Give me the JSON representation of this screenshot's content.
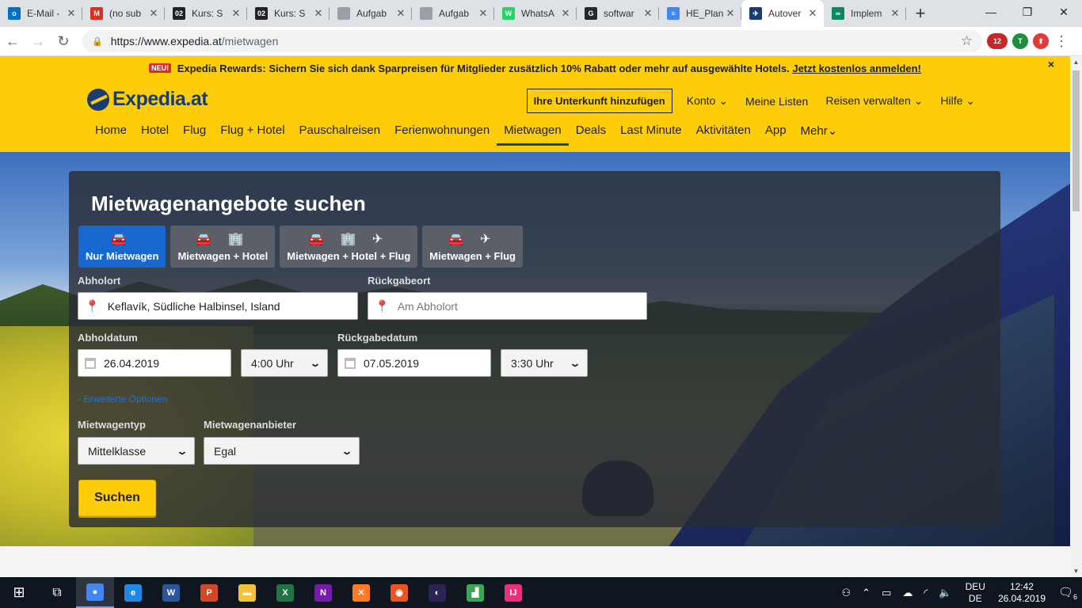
{
  "browser": {
    "tabs": [
      {
        "title": "E-Mail -",
        "icon": "outlook-icon",
        "color": "#0072c6",
        "glyph": "o"
      },
      {
        "title": "(no sub",
        "icon": "gmail-icon",
        "color": "#d93025",
        "glyph": "M"
      },
      {
        "title": "Kurs: S",
        "icon": "moodle-icon",
        "color": "#222",
        "glyph": "02"
      },
      {
        "title": "Kurs: S",
        "icon": "moodle-icon",
        "color": "#222",
        "glyph": "02"
      },
      {
        "title": "Aufgab",
        "icon": "document-icon",
        "color": "#9aa0a6",
        "glyph": ""
      },
      {
        "title": "Aufgab",
        "icon": "document-icon",
        "color": "#9aa0a6",
        "glyph": ""
      },
      {
        "title": "WhatsA",
        "icon": "whatsapp-icon",
        "color": "#25d366",
        "glyph": "W"
      },
      {
        "title": "softwar",
        "icon": "github-icon",
        "color": "#24292e",
        "glyph": "G"
      },
      {
        "title": "HE_Plan",
        "icon": "google-docs-icon",
        "color": "#4285f4",
        "glyph": "≡"
      },
      {
        "title": "Autover",
        "icon": "expedia-icon",
        "color": "#1a3c6e",
        "glyph": "✈",
        "active": true
      },
      {
        "title": "Implem",
        "icon": "infinity-icon",
        "color": "#0a8a5c",
        "glyph": "∞"
      }
    ],
    "new_tab": "+",
    "url_host": "https://www.expedia.at",
    "url_path": "/mietwagen",
    "ext_badge": "12",
    "profile_initial": "T"
  },
  "header": {
    "promo_badge": "NEU!",
    "promo_text": "Expedia Rewards: Sichern Sie sich dank Sparpreisen für Mitglieder zusätzlich 10% Rabatt oder mehr auf ausgewählte Hotels.",
    "promo_link": "Jetzt kostenlos anmelden!",
    "promo_close": "×",
    "logo_text": "Expedia.at",
    "add_property": "Ihre Unterkunft hinzufügen",
    "account": "Konto",
    "my_lists": "Meine Listen",
    "manage_trips": "Reisen verwalten",
    "help": "Hilfe",
    "nav": [
      "Home",
      "Hotel",
      "Flug",
      "Flug + Hotel",
      "Pauschalreisen",
      "Ferienwohnungen",
      "Mietwagen",
      "Deals",
      "Last Minute",
      "Aktivitäten",
      "App",
      "Mehr"
    ]
  },
  "search": {
    "title": "Mietwagenangebote suchen",
    "tabs": [
      {
        "icons": "🚘",
        "label": "Nur Mietwagen"
      },
      {
        "icons": "🚘 🏢",
        "label": "Mietwagen + Hotel"
      },
      {
        "icons": "🚘 🏢 ✈",
        "label": "Mietwagen + Hotel + Flug"
      },
      {
        "icons": "🚘 ✈",
        "label": "Mietwagen + Flug"
      }
    ],
    "pickup_label": "Abholort",
    "pickup_value": "Keflavík, Südliche Halbinsel, Island",
    "dropoff_label": "Rückgabeort",
    "dropoff_placeholder": "Am Abholort",
    "pickup_date_label": "Abholdatum",
    "pickup_date": "26.04.2019",
    "pickup_time": "4:00 Uhr",
    "return_date_label": "Rückgabedatum",
    "return_date": "07.05.2019",
    "return_time": "3:30 Uhr",
    "advanced": "- Erweiterte Optionen",
    "car_type_label": "Mietwagentyp",
    "car_type": "Mittelklasse",
    "vendor_label": "Mietwagenanbieter",
    "vendor": "Egal",
    "submit": "Suchen"
  },
  "taskbar": {
    "apps": [
      {
        "name": "chrome-icon",
        "color": "#4285f4",
        "glyph": "●",
        "active": true
      },
      {
        "name": "edge-icon",
        "color": "#1e88e5",
        "glyph": "e"
      },
      {
        "name": "word-icon",
        "color": "#2b579a",
        "glyph": "W"
      },
      {
        "name": "powerpoint-icon",
        "color": "#d24726",
        "glyph": "P"
      },
      {
        "name": "explorer-icon",
        "color": "#f3c13a",
        "glyph": "▬"
      },
      {
        "name": "excel-icon",
        "color": "#217346",
        "glyph": "X"
      },
      {
        "name": "onenote-icon",
        "color": "#7719aa",
        "glyph": "N"
      },
      {
        "name": "xampp-icon",
        "color": "#fb7a24",
        "glyph": "✕"
      },
      {
        "name": "ubuntu-icon",
        "color": "#e95420",
        "glyph": "◉"
      },
      {
        "name": "eclipse-icon",
        "color": "#2c2255",
        "glyph": "◐"
      },
      {
        "name": "chart-app-icon",
        "color": "#3aa655",
        "glyph": "▟"
      },
      {
        "name": "intellij-icon",
        "color": "#e8317a",
        "glyph": "IJ"
      }
    ],
    "lang_top": "DEU",
    "lang_bottom": "DE",
    "time": "12:42",
    "date": "26.04.2019",
    "notifications": "6"
  }
}
